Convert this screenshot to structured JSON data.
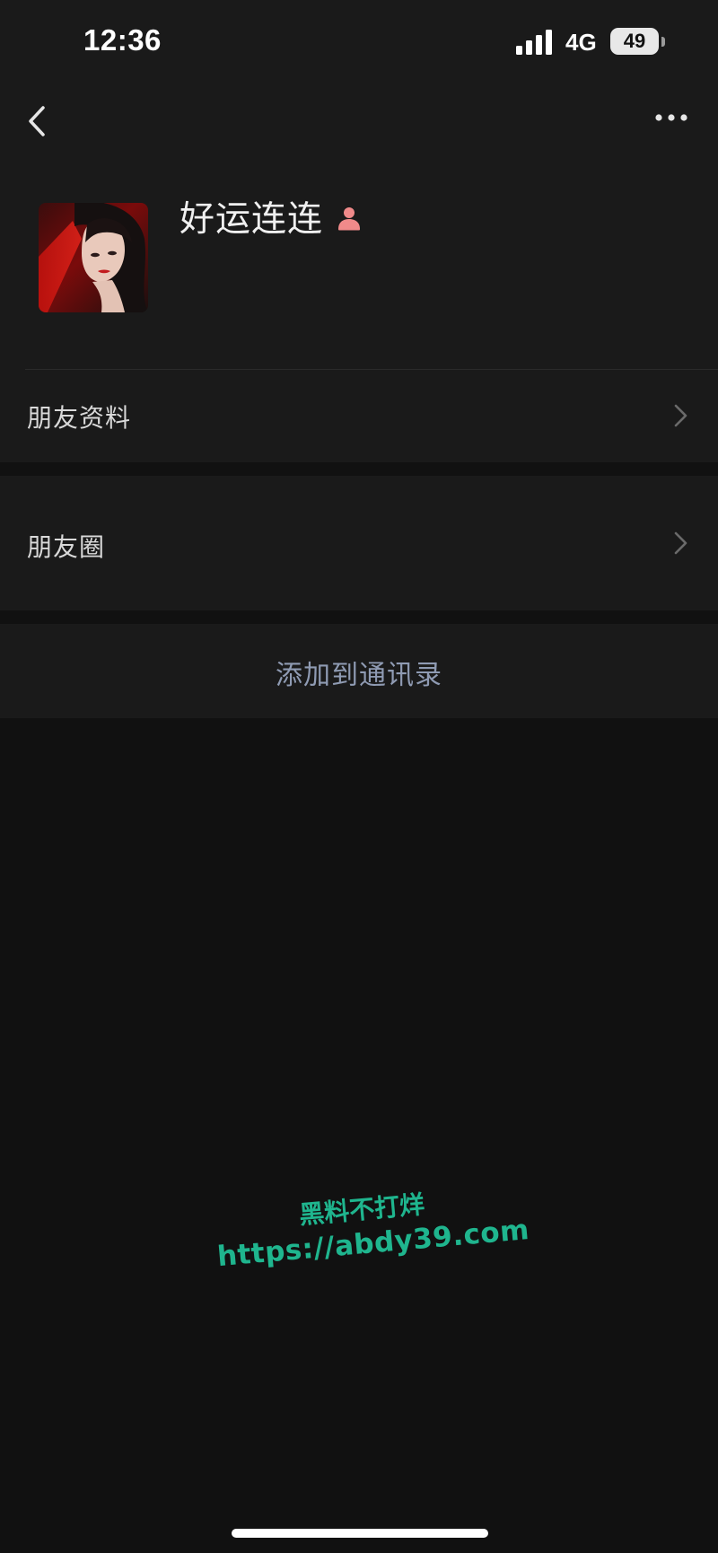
{
  "status_bar": {
    "time": "12:36",
    "network": "4G",
    "battery_level": "49",
    "signal_bars": 4
  },
  "nav": {
    "back_icon": "chevron-left-icon",
    "more_icon": "more-dots-icon"
  },
  "profile": {
    "name": "好运连连",
    "gender_icon": "female-icon",
    "gender_icon_color": "#f08a8a"
  },
  "rows": {
    "profile_info_label": "朋友资料",
    "moments_label": "朋友圈",
    "chevron_icon": "chevron-right-icon"
  },
  "actions": {
    "add_to_contacts_label": "添加到通讯录"
  },
  "watermark": {
    "line1": "黑料不打烊",
    "line2": "https://abdy39.com",
    "color": "#1fb58e"
  },
  "colors": {
    "background": "#111111",
    "card": "#1a1a1a",
    "link_text": "#8f9bb3"
  }
}
